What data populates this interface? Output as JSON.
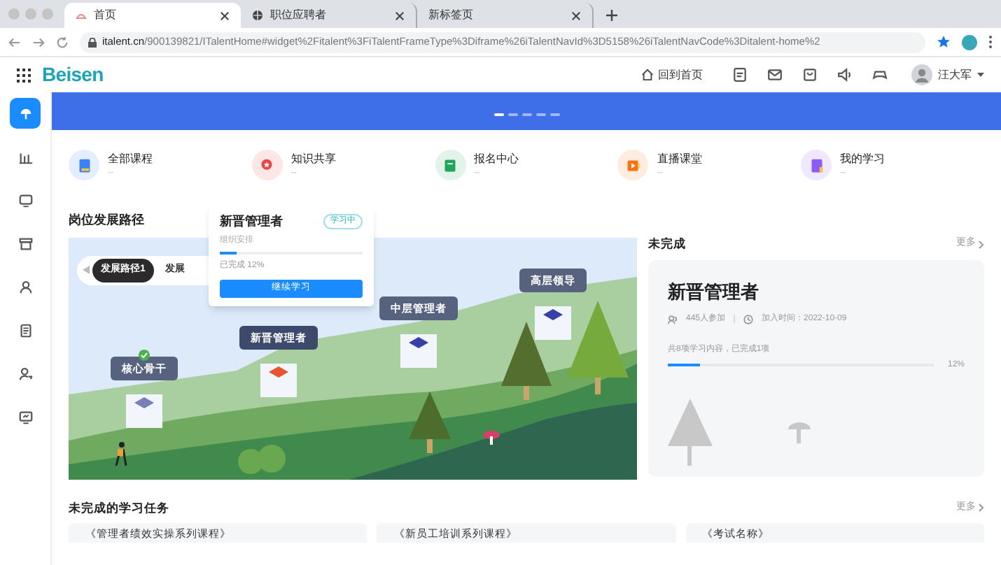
{
  "browser": {
    "tabs": [
      {
        "title": "首页",
        "selected": true
      },
      {
        "title": "职位应聘者",
        "selected": false
      },
      {
        "title": "新标签页",
        "selected": false
      }
    ],
    "url_host": "italent.cn",
    "url_path": "/900139821/ITalentHome#widget%2Fitalent%3FiTalentFrameType%3Diframe%26iTalentNavId%3D5158%26iTalentNavCode%3Ditalent-home%2"
  },
  "app_header": {
    "logo": "Beisen",
    "home_link": "回到首页",
    "user": "汪大军"
  },
  "banner": {
    "dots": [
      {
        "selected": true
      },
      {
        "selected": false
      },
      {
        "selected": false
      },
      {
        "selected": false
      },
      {
        "selected": false
      }
    ]
  },
  "sidebar": {
    "items": [
      {
        "selected": true
      },
      {
        "selected": false
      },
      {
        "selected": false
      },
      {
        "selected": false
      },
      {
        "selected": false
      },
      {
        "selected": false
      },
      {
        "selected": false
      },
      {
        "selected": false
      }
    ]
  },
  "shortcuts": [
    {
      "title": "全部课程",
      "subtitle": "--",
      "color": "#3b82f6"
    },
    {
      "title": "知识共享",
      "subtitle": "--",
      "color": "#ef4444"
    },
    {
      "title": "报名中心",
      "subtitle": "--",
      "color": "#22a55a"
    },
    {
      "title": "直播课堂",
      "subtitle": "--",
      "color": "#f97316"
    },
    {
      "title": "我的学习",
      "subtitle": "--",
      "color": "#8b5cf6"
    }
  ],
  "career_path": {
    "title": "岗位发展路径",
    "paths": [
      {
        "label": "发展路径1",
        "selected": true
      },
      {
        "label": "发展",
        "selected": false
      }
    ],
    "nodes": [
      {
        "label": "核心骨干",
        "done": true,
        "current": false
      },
      {
        "label": "新晋管理者",
        "done": false,
        "current": true
      },
      {
        "label": "中层管理者",
        "done": false,
        "current": false
      },
      {
        "label": "高层领导",
        "done": false,
        "current": false
      }
    ],
    "popup": {
      "title": "新晋管理者",
      "badge": "学习中",
      "source": "组织安排",
      "level": 0.12,
      "progress_text": "已完成 12%",
      "button": "继续学习"
    }
  },
  "unfinished": {
    "title": "未完成",
    "more": "更多",
    "card": {
      "title": "新晋管理者",
      "participants": "445人参加",
      "joined": "加入时间：2022-10-09",
      "summary": "共8项学习内容，已完成1项",
      "level": 0.12,
      "percent": "12%"
    }
  },
  "tasks": {
    "title": "未完成的学习任务",
    "more": "更多",
    "items": [
      "《管理者绩效实操系列课程》",
      "《新员工培训系列课程》",
      "《考试名称》"
    ]
  }
}
